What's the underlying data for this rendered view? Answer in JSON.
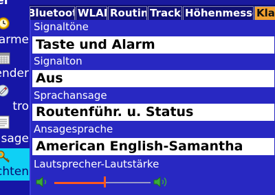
{
  "sidebar": {
    "title_fragment": "ttel",
    "items": [
      {
        "label": "arme",
        "icon": "clock-icon"
      },
      {
        "label": "ender",
        "icon": "calendar-icon"
      },
      {
        "label": "tro",
        "icon": "rocket-icon"
      },
      {
        "label": "sage",
        "icon": "notepad-icon"
      },
      {
        "label": "chten",
        "icon": "key-icon",
        "active": true
      }
    ]
  },
  "tabs": [
    {
      "label": "Bluetooth"
    },
    {
      "label": "WLAN"
    },
    {
      "label": "Routing"
    },
    {
      "label": "Tracks"
    },
    {
      "label": "Höhenmesser"
    },
    {
      "label": "Klang",
      "active": true
    }
  ],
  "settings": {
    "signaltoene_label": "Signaltöne",
    "signaltoene_value": "Taste und Alarm",
    "signalton_label": "Signalton",
    "signalton_value": "Aus",
    "sprachansage_label": "Sprachansage",
    "sprachansage_value": "Routenführ. u. Status",
    "ansagesprache_label": "Ansagesprache",
    "ansagesprache_value": "American English-Samantha",
    "lautstaerke_label": "Lautsprecher-Lautstärke",
    "lautstaerke_level": 0.52
  },
  "colors": {
    "background": "#1a1a9e",
    "panel": "#2828c2",
    "active_tab": "#f0a030",
    "active_side": "#0fd0f5",
    "slider": "#ff5a1e"
  }
}
